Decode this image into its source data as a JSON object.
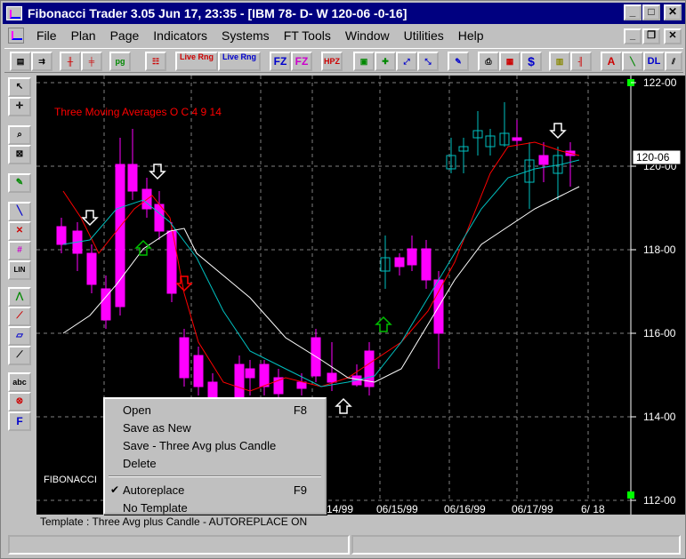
{
  "window": {
    "title": "Fibonacci Trader 3.05 Jun 17,  23:35 - [IBM  78- D- W 120-06    -0-16]",
    "minimize_label": "_",
    "maximize_label": "□",
    "close_label": "✕",
    "mdi_minimize_label": "_",
    "mdi_restore_label": "❐",
    "mdi_close_label": "✕"
  },
  "menubar": {
    "items": [
      "File",
      "Plan",
      "Page",
      "Indicators",
      "Systems",
      "FT Tools",
      "Window",
      "Utilities",
      "Help"
    ]
  },
  "toolbar": {
    "pg_label": "pg",
    "live_rng_1": "Live Rng",
    "live_rng_2": "Live Rng",
    "fz_label": "FZ",
    "fz2_label": "FZ",
    "hpz_label": "HPZ",
    "dollar_label": "$",
    "dl_label": "DL",
    "a_label": "A"
  },
  "sidebar": {
    "lin_label": "LIN",
    "abc_label": "abc",
    "f_label": "F"
  },
  "chart": {
    "study_label": "Three Moving Averages O C 4 9 14",
    "watermark": "FIBONACCI",
    "price_labels": [
      "122-00",
      "120-00",
      "118-00",
      "116-00",
      "114-00",
      "112-00"
    ],
    "last_price": "120-06",
    "date_labels": [
      "14/99",
      "06/15/99",
      "06/16/99",
      "06/17/99",
      "6/ 18"
    ],
    "colors": {
      "background": "#000000",
      "bull_candle": "#00c0c0",
      "bear_candle": "#ff00ff",
      "ma_fast": "#ff0000",
      "ma_mid": "#00c0c0",
      "ma_slow": "#ffffff",
      "label_red": "#ff0000"
    }
  },
  "status": {
    "template_text": "Template : Three Avg plus Candle - AUTOREPLACE ON"
  },
  "context_menu": {
    "open": "Open",
    "open_key": "F8",
    "save_new": "Save as New",
    "save_named": "Save - Three Avg plus Candle",
    "delete": "Delete",
    "autoreplace": "Autoreplace",
    "autoreplace_key": "F9",
    "no_template": "No Template",
    "check": "✔"
  }
}
